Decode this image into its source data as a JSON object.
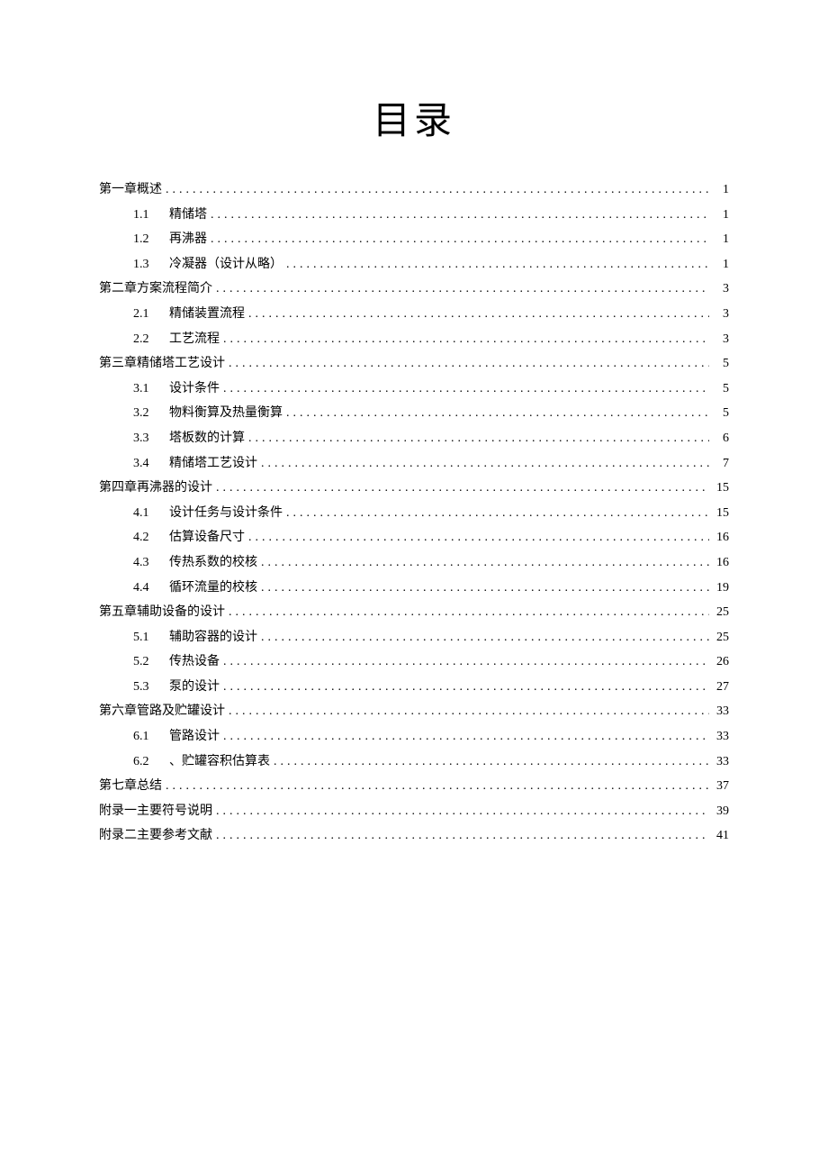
{
  "title": "目录",
  "toc": [
    {
      "level": 1,
      "num": "",
      "text": "第一章概述",
      "page": "1"
    },
    {
      "level": 2,
      "num": "1.1",
      "text": "精储塔",
      "page": "1"
    },
    {
      "level": 2,
      "num": "1.2",
      "text": "再沸器",
      "page": "1"
    },
    {
      "level": 2,
      "num": "1.3",
      "text": "冷凝器（设计从略）",
      "page": "1"
    },
    {
      "level": 1,
      "num": "",
      "text": "第二章方案流程简介",
      "page": "3"
    },
    {
      "level": 2,
      "num": "2.1",
      "text": "精储装置流程",
      "page": "3"
    },
    {
      "level": 2,
      "num": "2.2",
      "text": "工艺流程",
      "page": "3"
    },
    {
      "level": 1,
      "num": "",
      "text": "第三章精储塔工艺设计",
      "page": "5"
    },
    {
      "level": 2,
      "num": "3.1",
      "text": "设计条件",
      "page": "5"
    },
    {
      "level": 2,
      "num": "3.2",
      "text": "物料衡算及热量衡算",
      "page": "5"
    },
    {
      "level": 2,
      "num": "3.3",
      "text": "塔板数的计算",
      "page": "6"
    },
    {
      "level": 2,
      "num": "3.4",
      "text": "精储塔工艺设计",
      "page": "7"
    },
    {
      "level": 1,
      "num": "",
      "text": "第四章再沸器的设计",
      "page": "15"
    },
    {
      "level": 2,
      "num": "4.1",
      "text": "设计任务与设计条件",
      "page": "15"
    },
    {
      "level": 2,
      "num": "4.2",
      "text": "估算设备尺寸",
      "page": "16"
    },
    {
      "level": 2,
      "num": "4.3",
      "text": "传热系数的校核",
      "page": "16"
    },
    {
      "level": 2,
      "num": "4.4",
      "text": "循环流量的校核",
      "page": "19"
    },
    {
      "level": 1,
      "num": "",
      "text": "第五章辅助设备的设计",
      "page": "25"
    },
    {
      "level": 2,
      "num": "5.1",
      "text": "辅助容器的设计",
      "page": "25"
    },
    {
      "level": 2,
      "num": "5.2",
      "text": "传热设备",
      "page": "26"
    },
    {
      "level": 2,
      "num": "5.3",
      "text": "泵的设计",
      "page": "27"
    },
    {
      "level": 1,
      "num": "",
      "text": "第六章管路及贮罐设计",
      "page": "33"
    },
    {
      "level": 2,
      "num": "6.1",
      "text": "管路设计",
      "page": "33"
    },
    {
      "level": 2,
      "num": "6.2",
      "text": "、贮罐容积估算表",
      "page": "33"
    },
    {
      "level": 1,
      "num": "",
      "text": "第七章总结",
      "page": "37"
    },
    {
      "level": 1,
      "num": "",
      "text": "附录一主要符号说明",
      "page": "39"
    },
    {
      "level": 1,
      "num": "",
      "text": "附录二主要参考文献",
      "page": "41"
    }
  ]
}
